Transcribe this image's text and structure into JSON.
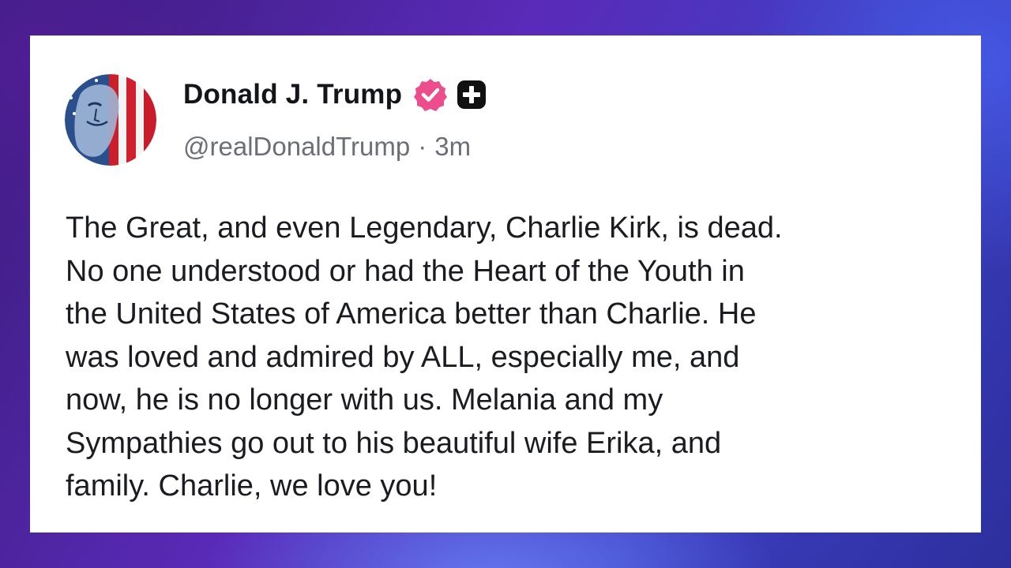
{
  "post": {
    "author": {
      "display_name": "Donald J. Trump",
      "handle": "@realDonaldTrump",
      "avatar_icon": "flag-portrait-avatar",
      "verified_icon": "verified-badge-icon",
      "extra_icon": "plus-square-icon"
    },
    "separator": "·",
    "timestamp": "3m",
    "body_lines": [
      "The Great, and even Legendary, Charlie Kirk, is dead.",
      "No one understood or had the Heart of the Youth in",
      "the United States of America better than Charlie. He",
      "was loved and admired by ALL, especially me, and",
      "now, he is no longer with us. Melania and my",
      "Sympathies go out to his beautiful wife Erika, and",
      "family. Charlie, we love you!"
    ]
  },
  "colors": {
    "card_background": "#ffffff",
    "name_text": "#14151a",
    "handle_text": "#6c6e78",
    "body_text": "#1b1c22",
    "verified_badge": "#ec4d8c",
    "plus_icon_bg": "#111111"
  }
}
